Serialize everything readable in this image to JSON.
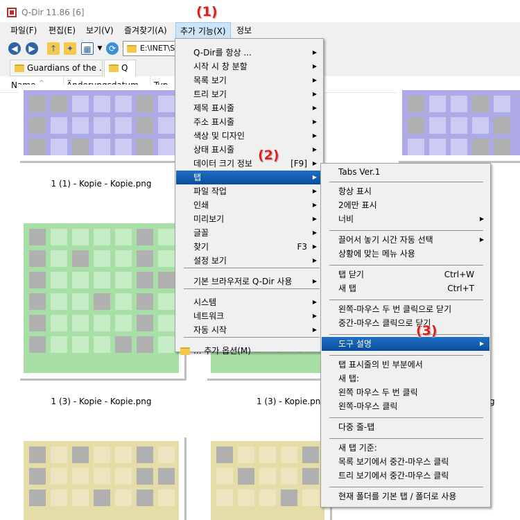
{
  "window": {
    "title": "Q-Dir 11.86 [6]"
  },
  "menubar": [
    "파일(F)",
    "편집(E)",
    "보기(V)",
    "즐겨찾기(A)",
    "추가 기능(X)",
    "정보"
  ],
  "toolbar": {
    "address": "E:\\INET\\So"
  },
  "tabs": [
    "Guardians of the ...",
    "Q"
  ],
  "columns": [
    "Name",
    "Änderungsdatum",
    "Typ"
  ],
  "sort_glyph": "^",
  "files": [
    "1 (1) - Kopie - Kopie.png",
    "1 (3) - Kopie - Kopie.png",
    "1 (3) - Kopie.png"
  ],
  "partial_labels": [
    "ng",
    "g"
  ],
  "colors": {
    "thumb_blue_light": "#cccbf3",
    "thumb_blue_frame": "#aeaae6",
    "thumb_green_light": "#c6ecc6",
    "thumb_green_frame": "#a7dfa7",
    "thumb_yellow_light": "#ede5c0",
    "thumb_yellow_frame": "#e5dda7",
    "thumb_dark": "#b0b0b0",
    "highlight": "#0a58ab"
  },
  "menu1": [
    {
      "label": "Q-Dir를 항상 ...",
      "sub": true
    },
    {
      "label": "시작 시 창 분할",
      "sub": true
    },
    {
      "label": "목록 보기",
      "sub": true
    },
    {
      "label": "트리 보기",
      "sub": true
    },
    {
      "label": "제목 표시줄",
      "sub": true
    },
    {
      "label": "주소 표시줄",
      "sub": true
    },
    {
      "label": "색상 및 디자인",
      "sub": true
    },
    {
      "label": "상태 표시줄",
      "sub": true
    },
    {
      "label": "데이터 크기 정보",
      "shortcut": "[F9]",
      "sub": true
    },
    {
      "label": "탭",
      "sub": true
    },
    {
      "label": "파일 작업",
      "sub": true
    },
    {
      "label": "인쇄",
      "sub": true
    },
    {
      "label": "미리보기",
      "sub": true
    },
    {
      "label": "글꼴",
      "sub": true
    },
    {
      "label": "찾기",
      "shortcut": "F3",
      "sub": true
    },
    {
      "label": "설정 보기",
      "sub": true
    },
    {
      "label": "기본 브라우저로 Q-Dir 사용",
      "sub": true
    },
    {
      "label": "시스템",
      "sub": true
    },
    {
      "label": "네트워크",
      "sub": true
    },
    {
      "label": "자동 시작",
      "sub": true
    },
    {
      "label": "... 추가 옵션(M)",
      "sub": false
    }
  ],
  "menu2": [
    {
      "label": "Tabs Ver.1"
    },
    {
      "label": "항상 표시"
    },
    {
      "label": "2에만 표시"
    },
    {
      "label": "너비",
      "sub": true
    },
    {
      "label": "끌어서 놓기 시간 자동 선택",
      "sub": true
    },
    {
      "label": "상황에 맞는 메뉴 사용"
    },
    {
      "label": "탭 닫기",
      "shortcut": "Ctrl+W"
    },
    {
      "label": "새 탭",
      "shortcut": "Ctrl+T"
    },
    {
      "label": "왼쪽-마우스 두 번 클릭으로 닫기"
    },
    {
      "label": "중간-마우스 클릭으로 닫기"
    },
    {
      "label": "도구 설명",
      "sub": true
    },
    {
      "label": "탭 표시줄의 빈 부분에서"
    },
    {
      "label": "새 탭:"
    },
    {
      "label": "왼쪽 마우스 두 번 클릭"
    },
    {
      "label": "왼쪽-마우스 클릭"
    },
    {
      "label": "다중 줄-탭"
    },
    {
      "label": "새 탭 기준:"
    },
    {
      "label": "목록 보기에서 중간-마우스 클릭"
    },
    {
      "label": "트리 보기에서 중간-마우스 클릭"
    },
    {
      "label": "현재 폴더를 기본 탭 / 폴더로 사용"
    }
  ],
  "badges": [
    "(1)",
    "(2)",
    "(3)"
  ]
}
